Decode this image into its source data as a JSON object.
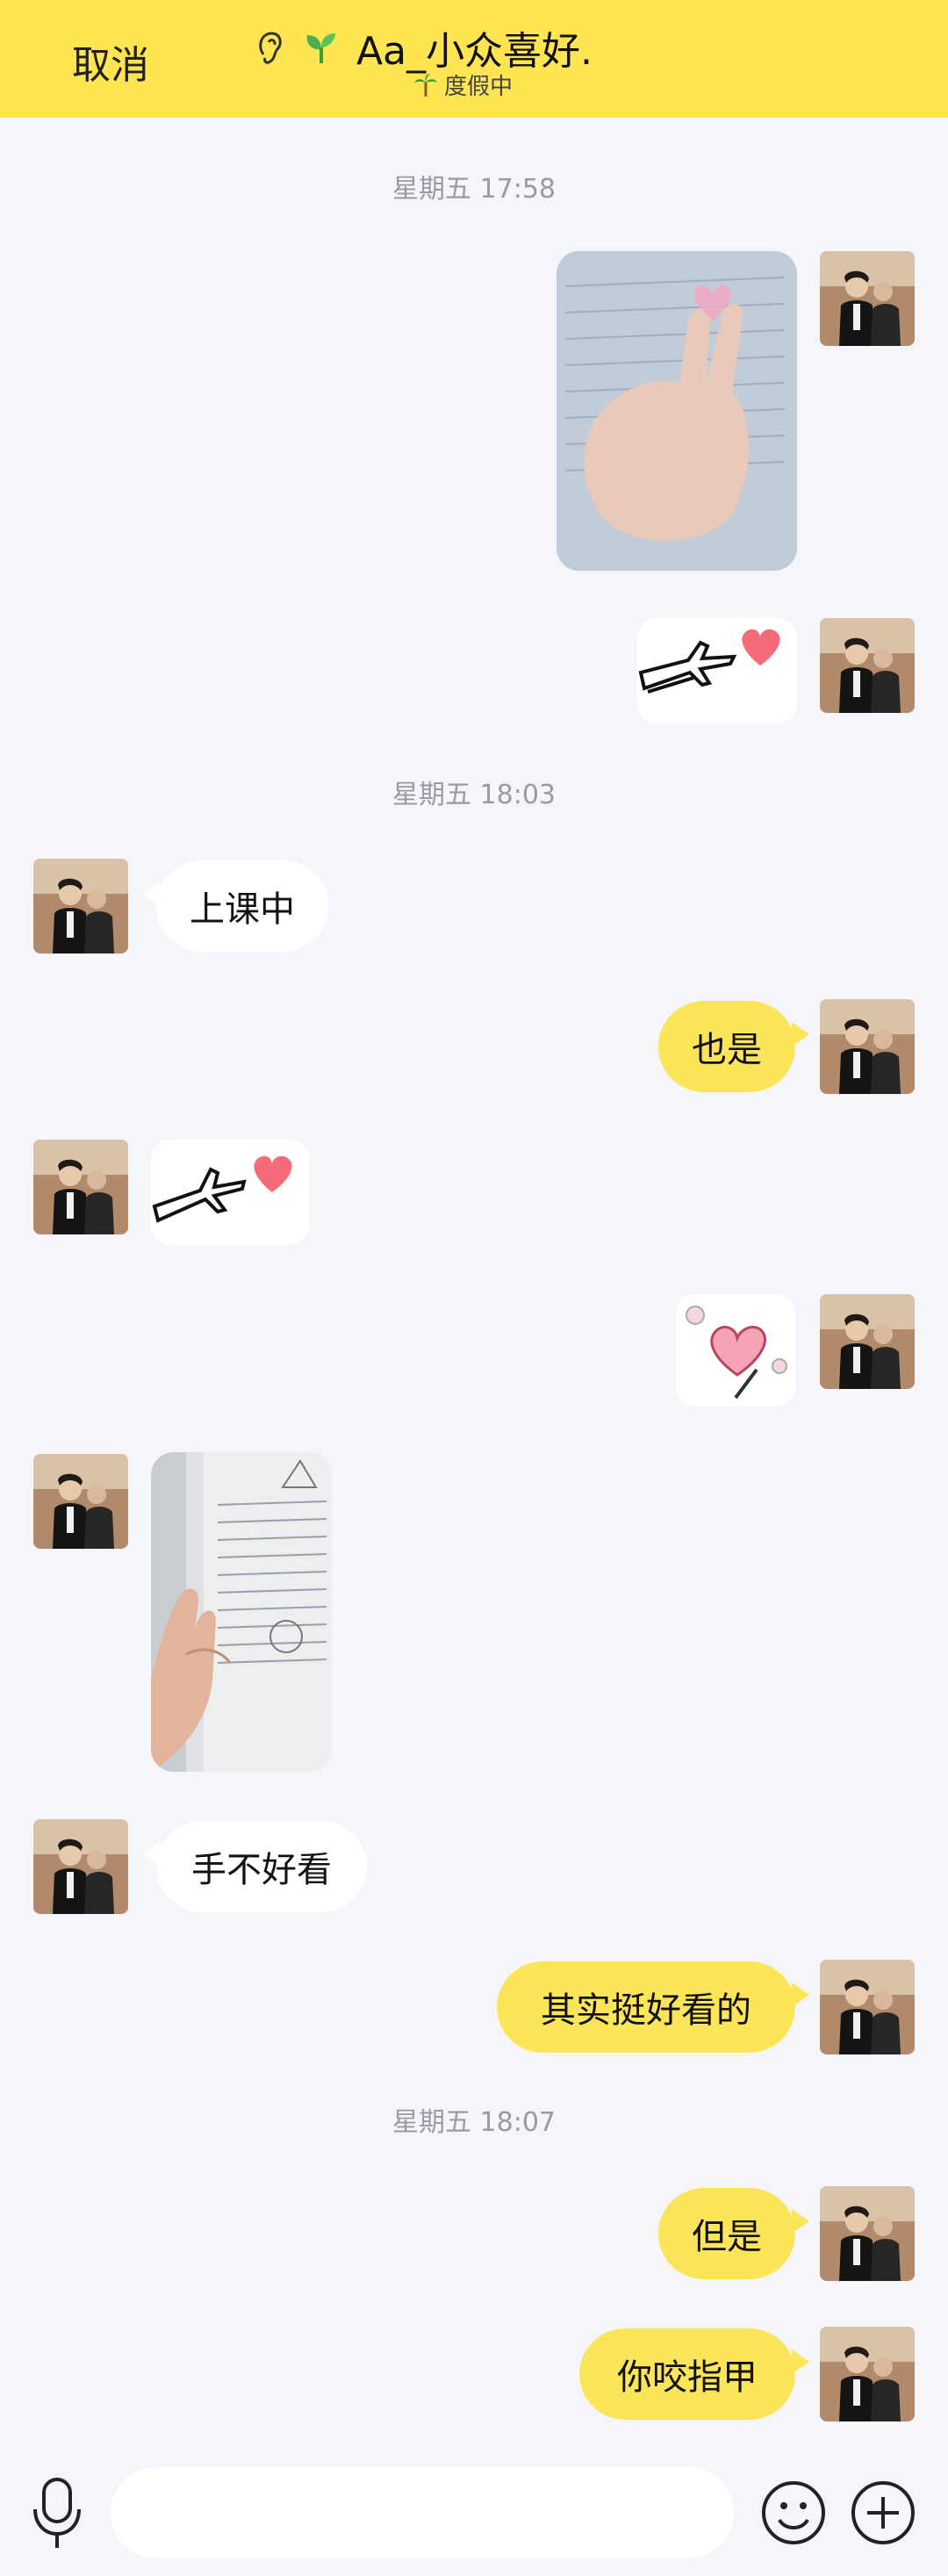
{
  "header": {
    "cancel_label": "取消",
    "contact_name": "Aa_小众喜好.",
    "contact_status": "度假中",
    "ear_icon": "ear-icon",
    "sprout_icon": "sprout-icon",
    "palm_icon": "palm-tree-icon"
  },
  "messages": {
    "time_1": "星期五 17:58",
    "time_2": "星期五 18:03",
    "time_3": "星期五 18:07",
    "m_shangkezhong": "上课中",
    "m_yeshi": "也是",
    "m_shoubuhaokan": "手不好看",
    "m_qishitinghaokande": "其实挺好看的",
    "m_danshi": "但是",
    "m_niyaozhijia": "你咬指甲"
  },
  "input": {
    "placeholder": ""
  },
  "colors": {
    "header_bg": "#ffe552",
    "outgoing_bubble": "#fde55a",
    "incoming_bubble": "#ffffff",
    "chat_bg": "#f5f6fc",
    "heart": "#f56b7a"
  }
}
